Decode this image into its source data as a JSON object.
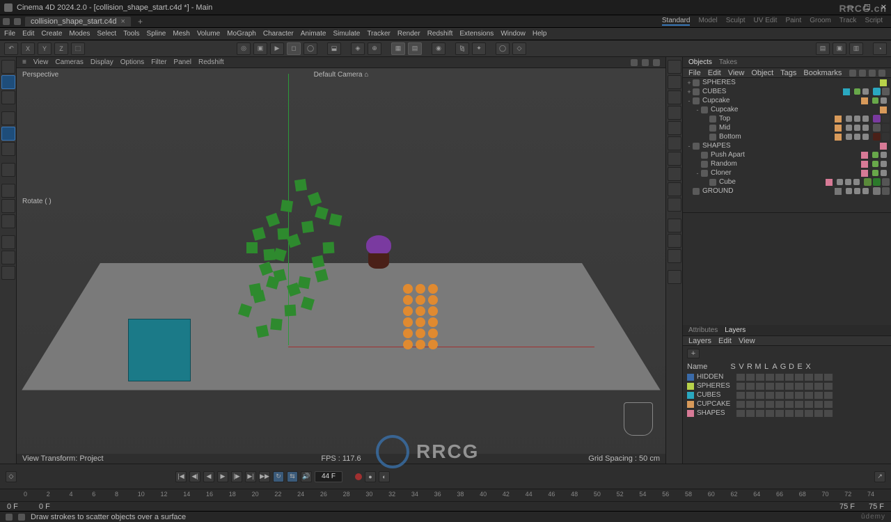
{
  "title": "Cinema 4D 2024.2.0 - [collision_shape_start.c4d *] - Main",
  "watermark_small": "RRCG.cn",
  "watermark_big": "RRCG",
  "file_tab": "collision_shape_start.c4d",
  "modes": [
    "Standard",
    "Model",
    "Sculpt",
    "UV Edit",
    "Paint",
    "Groom",
    "Track",
    "Script"
  ],
  "active_mode": 0,
  "menu": [
    "File",
    "Edit",
    "Create",
    "Modes",
    "Select",
    "Tools",
    "Spline",
    "Mesh",
    "Volume",
    "MoGraph",
    "Character",
    "Animate",
    "Simulate",
    "Tracker",
    "Render",
    "Redshift",
    "Extensions",
    "Window",
    "Help"
  ],
  "axis_buttons": [
    "X",
    "Y",
    "Z"
  ],
  "vp_menu": [
    "View",
    "Cameras",
    "Display",
    "Options",
    "Filter",
    "Panel",
    "Redshift"
  ],
  "vp_menu_icon": "≡",
  "vp_label": "Perspective",
  "vp_camera": "Default Camera ⌂",
  "vp_rotate": "Rotate ( )",
  "vp_info_left": "View Transform: Project",
  "vp_info_mid": "FPS : 117.6",
  "vp_info_right": "Grid Spacing : 50 cm",
  "panel_tabs_top": [
    "Objects",
    "Takes"
  ],
  "obj_menu": [
    "File",
    "Edit",
    "View",
    "Object",
    "Tags",
    "Bookmarks"
  ],
  "tree": [
    {
      "d": 0,
      "exp": "+",
      "name": "SPHERES",
      "color": "#b7d24a"
    },
    {
      "d": 0,
      "exp": "+",
      "name": "CUBES",
      "color": "#2aa8c0",
      "dots": true,
      "tags": 2,
      "tagcolors": [
        "#2aa8c0",
        "#5a5a5a"
      ]
    },
    {
      "d": 0,
      "exp": "-",
      "name": "Cupcake",
      "color": "#d89a5a",
      "dots": true
    },
    {
      "d": 1,
      "exp": "-",
      "name": "Cupcake",
      "color": "#d89a5a"
    },
    {
      "d": 2,
      "exp": "",
      "name": "Top",
      "color": "#d89a5a",
      "dots": false,
      "rowdots": true,
      "tags": 2,
      "tagcolors": [
        "#7a3aa0",
        "#333"
      ]
    },
    {
      "d": 2,
      "exp": "",
      "name": "Mid",
      "color": "#d89a5a",
      "dots": false,
      "rowdots": true,
      "tags": 2,
      "tagcolors": [
        "#555",
        "#333"
      ]
    },
    {
      "d": 2,
      "exp": "",
      "name": "Bottom",
      "color": "#d89a5a",
      "dots": false,
      "rowdots": true,
      "tags": 2,
      "tagcolors": [
        "#4a2018",
        "#333"
      ]
    },
    {
      "d": 0,
      "exp": "-",
      "name": "SHAPES",
      "color": "#d77a96"
    },
    {
      "d": 1,
      "exp": "",
      "name": "Push Apart",
      "color": "#d77a96",
      "dots": true
    },
    {
      "d": 1,
      "exp": "",
      "name": "Random",
      "color": "#d77a96",
      "dots": true
    },
    {
      "d": 1,
      "exp": "-",
      "name": "Cloner",
      "color": "#d77a96",
      "dots": true
    },
    {
      "d": 2,
      "exp": "",
      "name": "Cube",
      "color": "#d77a96",
      "rowdots": true,
      "tags": 3,
      "tagcolors": [
        "#5a8a3a",
        "#2b7a2b",
        "#555"
      ]
    },
    {
      "d": 0,
      "exp": "",
      "name": "GROUND",
      "color": "#777",
      "rowdots": true,
      "tags": 2,
      "tagcolors": [
        "#777",
        "#555"
      ]
    }
  ],
  "attr_tabs": [
    "Attributes",
    "Layers"
  ],
  "attr_active": 1,
  "layers_menu": [
    "Layers",
    "Edit",
    "View"
  ],
  "layer_cols": [
    "S",
    "V",
    "R",
    "M",
    "L",
    "A",
    "G",
    "D",
    "E",
    "X"
  ],
  "layer_col_name": "Name",
  "layers": [
    {
      "name": "HIDDEN",
      "color": "#3a6aa8"
    },
    {
      "name": "SPHERES",
      "color": "#b7d24a"
    },
    {
      "name": "CUBES",
      "color": "#2aa8c0"
    },
    {
      "name": "CUPCAKE",
      "color": "#d89a5a"
    },
    {
      "name": "SHAPES",
      "color": "#d77a96"
    }
  ],
  "timeline_frame": "44 F",
  "timeline_min": 0,
  "timeline_max": 74,
  "timeline_ticks": [
    0,
    2,
    4,
    6,
    8,
    10,
    12,
    14,
    16,
    18,
    20,
    22,
    24,
    26,
    28,
    30,
    32,
    34,
    36,
    38,
    40,
    42,
    44,
    46,
    48,
    50,
    52,
    54,
    56,
    58,
    60,
    62,
    64,
    66,
    68,
    70,
    72,
    74
  ],
  "frame_status_left": "0 F",
  "frame_status_left2": "0 F",
  "frame_status_right": "75 F",
  "frame_status_right2": "75 F",
  "status_text": "Draw strokes to scatter objects over a surface",
  "brand_footer": "ûdemy",
  "add_label": "+"
}
